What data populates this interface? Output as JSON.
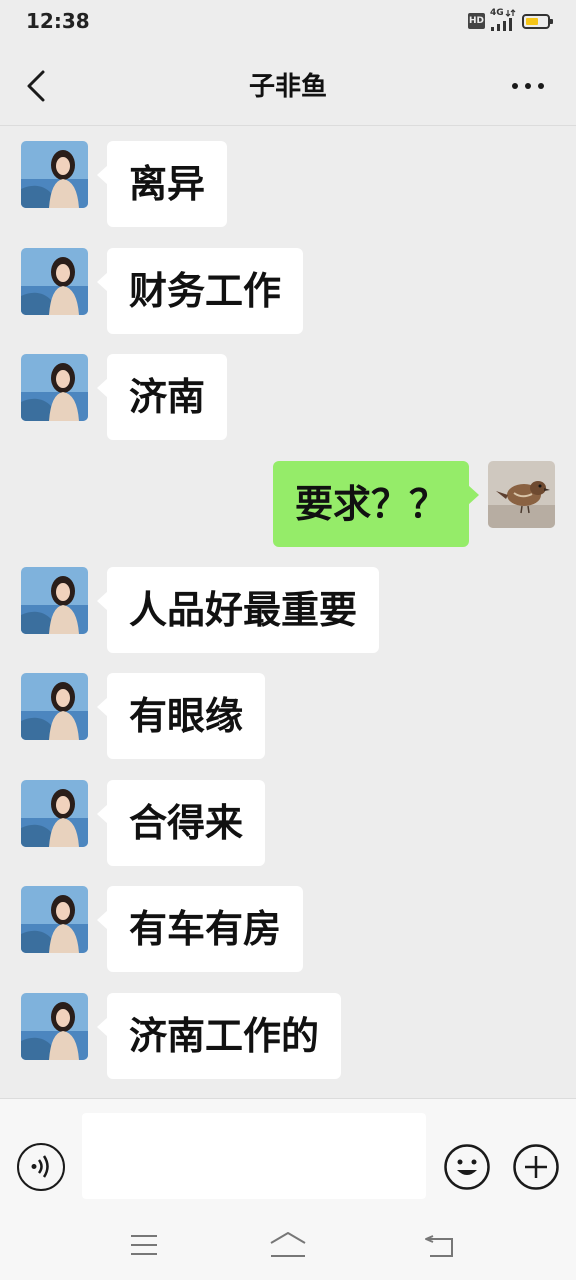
{
  "status_bar": {
    "time": "12:38",
    "hd_badge": "HD",
    "network": "4G",
    "icons": [
      "hd-icon",
      "signal-4g-icon",
      "battery-icon"
    ],
    "battery_color": "#f5c518"
  },
  "header": {
    "title": "子非鱼",
    "back_icon": "chevron-left-icon",
    "more_icon": "more-dots-icon"
  },
  "messages": [
    {
      "side": "left",
      "text": "离异"
    },
    {
      "side": "left",
      "text": "财务工作"
    },
    {
      "side": "left",
      "text": "济南"
    },
    {
      "side": "right",
      "text": "要求？？"
    },
    {
      "side": "left",
      "text": "人品好最重要"
    },
    {
      "side": "left",
      "text": "有眼缘"
    },
    {
      "side": "left",
      "text": "合得来"
    },
    {
      "side": "left",
      "text": "有车有房"
    },
    {
      "side": "left",
      "text": "济南工作的"
    }
  ],
  "input_bar": {
    "value": "",
    "icons": [
      "voice-icon",
      "emoji-icon",
      "add-icon"
    ]
  },
  "nav_bar": {
    "icons": [
      "menu-icon",
      "home-icon",
      "back-icon"
    ]
  },
  "colors": {
    "background": "#ededed",
    "incoming_bubble": "#ffffff",
    "outgoing_bubble": "#95ec69",
    "text": "#111111"
  }
}
